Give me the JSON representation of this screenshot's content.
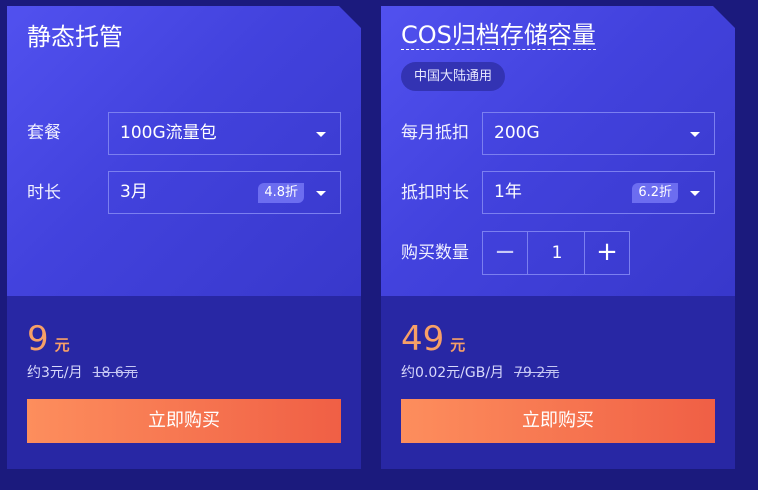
{
  "left_card": {
    "title": "静态托管",
    "package_label": "套餐",
    "package_value": "100G流量包",
    "duration_label": "时长",
    "duration_value": "3月",
    "duration_discount": "4.8折",
    "price": "9",
    "price_unit": "元",
    "unit_price": "约3元/月",
    "original_price": "18.6元",
    "buy_label": "立即购买"
  },
  "right_card": {
    "title": "COS归档存储容量",
    "region_tag": "中国大陆通用",
    "monthly_label": "每月抵扣",
    "monthly_value": "200G",
    "duration_label": "抵扣时长",
    "duration_value": "1年",
    "duration_discount": "6.2折",
    "quantity_label": "购买数量",
    "quantity_minus": "−",
    "quantity_value": "1",
    "quantity_plus": "+",
    "price": "49",
    "price_unit": "元",
    "unit_price": "约0.02元/GB/月",
    "original_price": "79.2元",
    "buy_label": "立即购买"
  },
  "colors": {
    "page_bg": "#1b1a7d",
    "card_top": "#4a4ae6",
    "card_bottom": "#2827a4",
    "price": "#f7a067",
    "buy_gradient_start": "#fd8e5d",
    "buy_gradient_end": "#f05f45"
  },
  "icons": {
    "caret": "chevron-down-icon",
    "minus": "minus-icon",
    "plus": "plus-icon"
  }
}
